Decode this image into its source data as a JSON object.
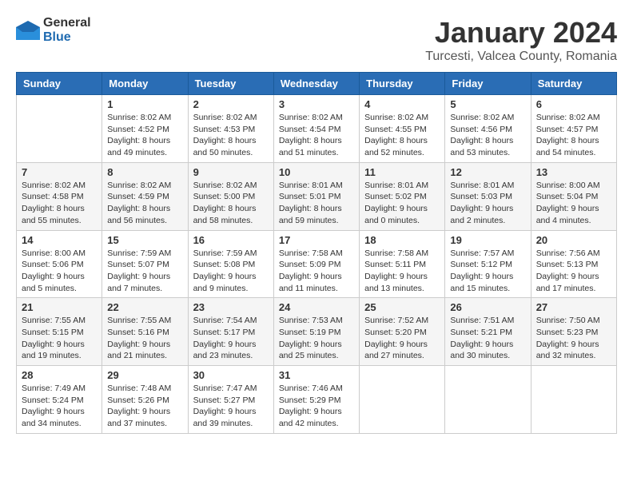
{
  "logo": {
    "text_general": "General",
    "text_blue": "Blue"
  },
  "title": "January 2024",
  "subtitle": "Turcesti, Valcea County, Romania",
  "days_of_week": [
    "Sunday",
    "Monday",
    "Tuesday",
    "Wednesday",
    "Thursday",
    "Friday",
    "Saturday"
  ],
  "weeks": [
    [
      {
        "day": "",
        "info": ""
      },
      {
        "day": "1",
        "info": "Sunrise: 8:02 AM\nSunset: 4:52 PM\nDaylight: 8 hours\nand 49 minutes."
      },
      {
        "day": "2",
        "info": "Sunrise: 8:02 AM\nSunset: 4:53 PM\nDaylight: 8 hours\nand 50 minutes."
      },
      {
        "day": "3",
        "info": "Sunrise: 8:02 AM\nSunset: 4:54 PM\nDaylight: 8 hours\nand 51 minutes."
      },
      {
        "day": "4",
        "info": "Sunrise: 8:02 AM\nSunset: 4:55 PM\nDaylight: 8 hours\nand 52 minutes."
      },
      {
        "day": "5",
        "info": "Sunrise: 8:02 AM\nSunset: 4:56 PM\nDaylight: 8 hours\nand 53 minutes."
      },
      {
        "day": "6",
        "info": "Sunrise: 8:02 AM\nSunset: 4:57 PM\nDaylight: 8 hours\nand 54 minutes."
      }
    ],
    [
      {
        "day": "7",
        "info": "Sunrise: 8:02 AM\nSunset: 4:58 PM\nDaylight: 8 hours\nand 55 minutes."
      },
      {
        "day": "8",
        "info": "Sunrise: 8:02 AM\nSunset: 4:59 PM\nDaylight: 8 hours\nand 56 minutes."
      },
      {
        "day": "9",
        "info": "Sunrise: 8:02 AM\nSunset: 5:00 PM\nDaylight: 8 hours\nand 58 minutes."
      },
      {
        "day": "10",
        "info": "Sunrise: 8:01 AM\nSunset: 5:01 PM\nDaylight: 8 hours\nand 59 minutes."
      },
      {
        "day": "11",
        "info": "Sunrise: 8:01 AM\nSunset: 5:02 PM\nDaylight: 9 hours\nand 0 minutes."
      },
      {
        "day": "12",
        "info": "Sunrise: 8:01 AM\nSunset: 5:03 PM\nDaylight: 9 hours\nand 2 minutes."
      },
      {
        "day": "13",
        "info": "Sunrise: 8:00 AM\nSunset: 5:04 PM\nDaylight: 9 hours\nand 4 minutes."
      }
    ],
    [
      {
        "day": "14",
        "info": "Sunrise: 8:00 AM\nSunset: 5:06 PM\nDaylight: 9 hours\nand 5 minutes."
      },
      {
        "day": "15",
        "info": "Sunrise: 7:59 AM\nSunset: 5:07 PM\nDaylight: 9 hours\nand 7 minutes."
      },
      {
        "day": "16",
        "info": "Sunrise: 7:59 AM\nSunset: 5:08 PM\nDaylight: 9 hours\nand 9 minutes."
      },
      {
        "day": "17",
        "info": "Sunrise: 7:58 AM\nSunset: 5:09 PM\nDaylight: 9 hours\nand 11 minutes."
      },
      {
        "day": "18",
        "info": "Sunrise: 7:58 AM\nSunset: 5:11 PM\nDaylight: 9 hours\nand 13 minutes."
      },
      {
        "day": "19",
        "info": "Sunrise: 7:57 AM\nSunset: 5:12 PM\nDaylight: 9 hours\nand 15 minutes."
      },
      {
        "day": "20",
        "info": "Sunrise: 7:56 AM\nSunset: 5:13 PM\nDaylight: 9 hours\nand 17 minutes."
      }
    ],
    [
      {
        "day": "21",
        "info": "Sunrise: 7:55 AM\nSunset: 5:15 PM\nDaylight: 9 hours\nand 19 minutes."
      },
      {
        "day": "22",
        "info": "Sunrise: 7:55 AM\nSunset: 5:16 PM\nDaylight: 9 hours\nand 21 minutes."
      },
      {
        "day": "23",
        "info": "Sunrise: 7:54 AM\nSunset: 5:17 PM\nDaylight: 9 hours\nand 23 minutes."
      },
      {
        "day": "24",
        "info": "Sunrise: 7:53 AM\nSunset: 5:19 PM\nDaylight: 9 hours\nand 25 minutes."
      },
      {
        "day": "25",
        "info": "Sunrise: 7:52 AM\nSunset: 5:20 PM\nDaylight: 9 hours\nand 27 minutes."
      },
      {
        "day": "26",
        "info": "Sunrise: 7:51 AM\nSunset: 5:21 PM\nDaylight: 9 hours\nand 30 minutes."
      },
      {
        "day": "27",
        "info": "Sunrise: 7:50 AM\nSunset: 5:23 PM\nDaylight: 9 hours\nand 32 minutes."
      }
    ],
    [
      {
        "day": "28",
        "info": "Sunrise: 7:49 AM\nSunset: 5:24 PM\nDaylight: 9 hours\nand 34 minutes."
      },
      {
        "day": "29",
        "info": "Sunrise: 7:48 AM\nSunset: 5:26 PM\nDaylight: 9 hours\nand 37 minutes."
      },
      {
        "day": "30",
        "info": "Sunrise: 7:47 AM\nSunset: 5:27 PM\nDaylight: 9 hours\nand 39 minutes."
      },
      {
        "day": "31",
        "info": "Sunrise: 7:46 AM\nSunset: 5:29 PM\nDaylight: 9 hours\nand 42 minutes."
      },
      {
        "day": "",
        "info": ""
      },
      {
        "day": "",
        "info": ""
      },
      {
        "day": "",
        "info": ""
      }
    ]
  ]
}
